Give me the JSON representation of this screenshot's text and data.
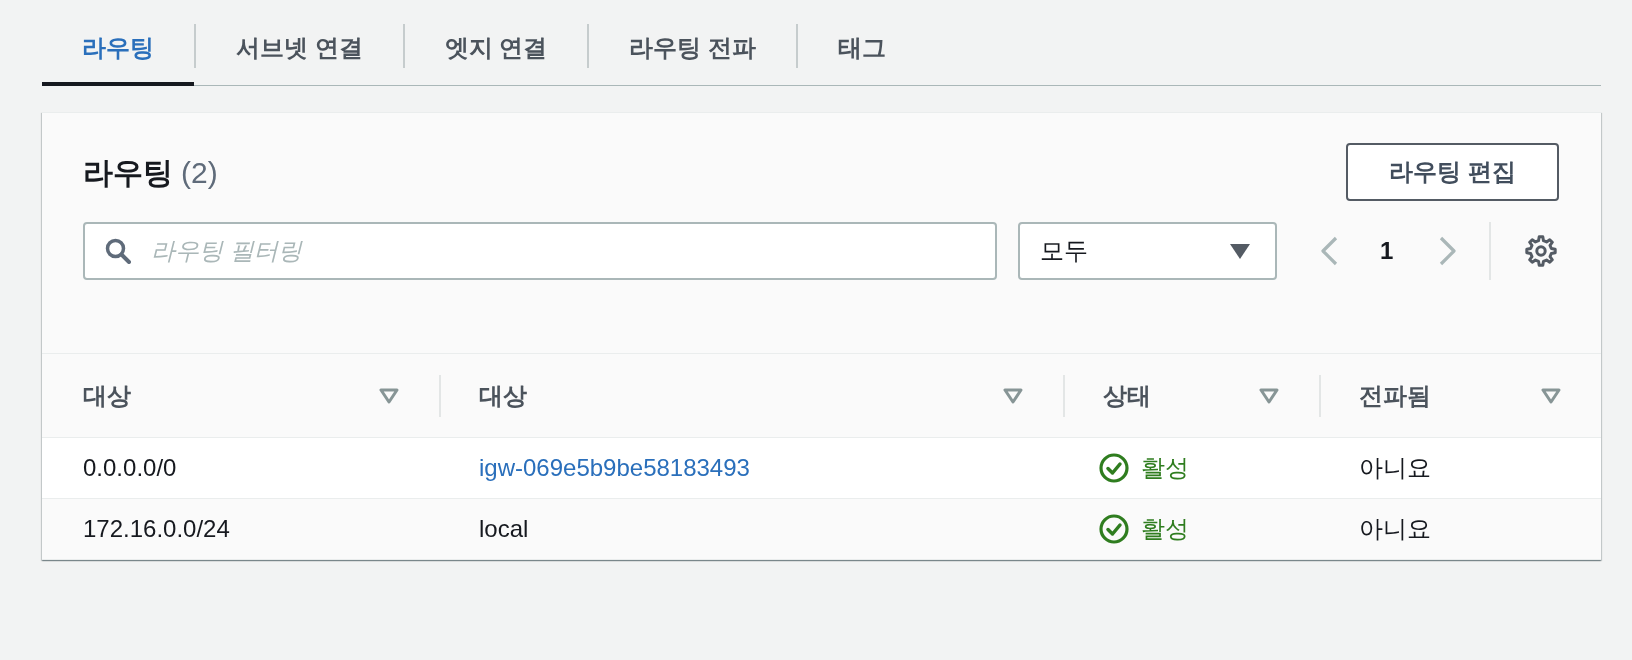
{
  "tabs": [
    {
      "label": "라우팅",
      "selected": true
    },
    {
      "label": "서브넷 연결",
      "selected": false
    },
    {
      "label": "엣지 연결",
      "selected": false
    },
    {
      "label": "라우팅 전파",
      "selected": false
    },
    {
      "label": "태그",
      "selected": false
    }
  ],
  "panel": {
    "title": "라우팅",
    "count": "(2)",
    "edit_button": "라우팅 편집"
  },
  "filter": {
    "search": {
      "placeholder": "라우팅 필터링"
    },
    "dropdown": {
      "value": "모두"
    },
    "pagination": {
      "prev": {
        "disabled": true
      },
      "pages": [
        {
          "label": "1",
          "selected": true
        }
      ],
      "next": {
        "disabled": true
      }
    }
  },
  "table": {
    "columns": [
      {
        "label": "대상"
      },
      {
        "label": "대상"
      },
      {
        "label": "상태"
      },
      {
        "label": "전파됨"
      }
    ],
    "rows": [
      {
        "destination": "0.0.0.0/0",
        "target": {
          "text": "igw-069e5b9be58183493",
          "kind": "link"
        },
        "status": {
          "text": "활성",
          "kind": "success"
        },
        "propagated": "아니요"
      },
      {
        "destination": "172.16.0.0/24",
        "target": {
          "text": "local",
          "kind": "plain"
        },
        "status": {
          "text": "활성",
          "kind": "success"
        },
        "propagated": "아니요"
      }
    ]
  }
}
